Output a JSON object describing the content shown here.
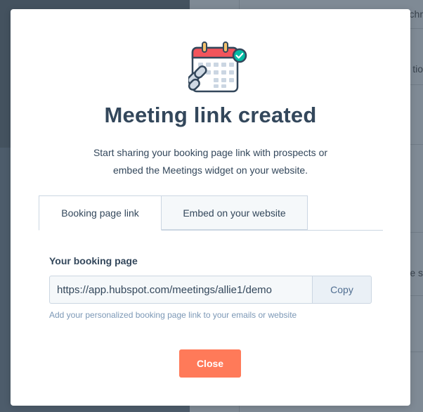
{
  "background": {
    "snippets": [
      "chr",
      "tio",
      "e s"
    ]
  },
  "modal": {
    "title": "Meeting link created",
    "subtitle_line1": "Start sharing your booking page link with prospects or",
    "subtitle_line2": "embed the Meetings widget on your website.",
    "tabs": [
      {
        "label": "Booking page link",
        "active": true
      },
      {
        "label": "Embed on your website",
        "active": false
      }
    ],
    "field_label": "Your booking page",
    "url_value": "https://app.hubspot.com/meetings/allie1/demo",
    "copy_label": "Copy",
    "help_text": "Add your personalized booking page link to your emails or website",
    "close_label": "Close"
  },
  "colors": {
    "primary_button": "#ff7a59",
    "heading": "#33475b",
    "calendar_header": "#f2545b",
    "check_badge": "#00bda5"
  },
  "icons": [
    "calendar-icon",
    "chain-link-icon",
    "checkmark-badge-icon"
  ]
}
